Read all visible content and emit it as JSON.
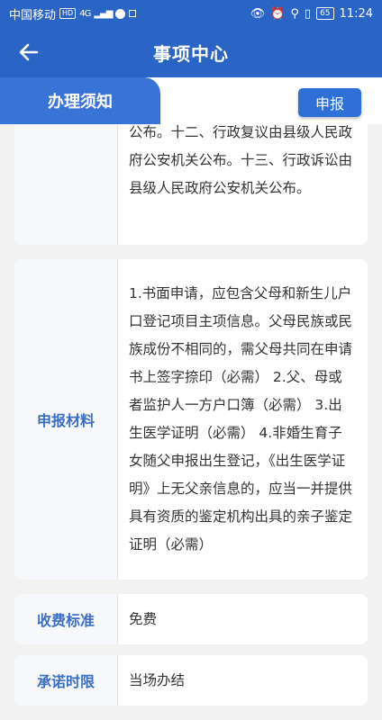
{
  "status_bar": {
    "carrier": "中国移动",
    "hd": "HD",
    "network": "4G",
    "battery": "65",
    "time": "11:24"
  },
  "header": {
    "title": "事项中心",
    "back_icon": "arrow-left-icon"
  },
  "tabs": {
    "active_tab": "办理须知",
    "submit_label": "申报"
  },
  "items": [
    {
      "label": "",
      "value": "公布。十二、行政复议由县级人民政府公安机关公布。十三、行政诉讼由县级人民政府公安机关公布。"
    },
    {
      "label": "申报材料",
      "value": "1.书面申请，应包含父母和新生儿户口登记项目主项信息。父母民族或民族成份不相同的，需父母共同在申请书上签字捺印（必需） 2.父、母或者监护人一方户口簿（必需） 3.出生医学证明（必需） 4.非婚生育子女随父申报出生登记，《出生医学证明》上无父亲信息的，应当一并提供具有资质的鉴定机构出具的亲子鉴定证明（必需）"
    },
    {
      "label": "收费标准",
      "value": "免费"
    },
    {
      "label": "承诺时限",
      "value": "当场办结"
    }
  ],
  "colors": {
    "primary": "#2a64c4",
    "tab_active": "#3a73d6",
    "label_text": "#3c6fc4"
  }
}
